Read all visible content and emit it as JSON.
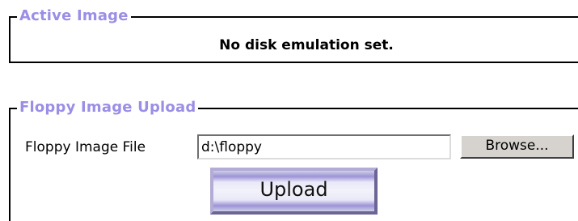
{
  "active_image": {
    "legend": "Active Image",
    "status_text": "No disk emulation set."
  },
  "floppy_upload": {
    "legend": "Floppy Image Upload",
    "file_label": "Floppy Image File",
    "file_value": "d:\\floppy",
    "browse_label": "Browse...",
    "upload_label": "Upload"
  },
  "colors": {
    "legend_text": "#9a8ee6",
    "upload_button_tint": "#9b93d6",
    "browse_button_face": "#d6d3ce"
  }
}
